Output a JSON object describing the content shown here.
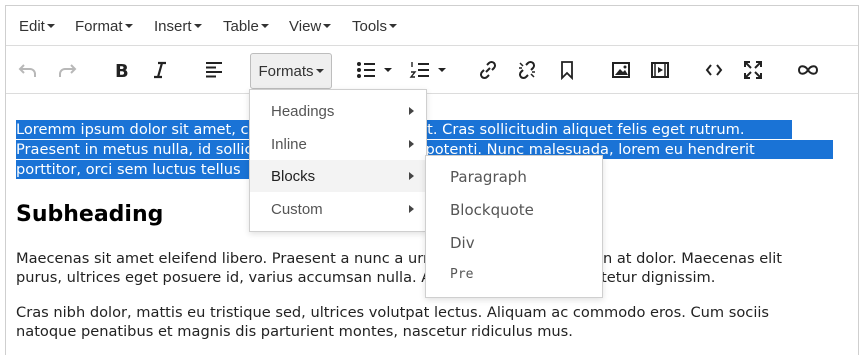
{
  "menubar": {
    "items": [
      {
        "label": "Edit"
      },
      {
        "label": "Format"
      },
      {
        "label": "Insert"
      },
      {
        "label": "Table"
      },
      {
        "label": "View"
      },
      {
        "label": "Tools"
      }
    ]
  },
  "toolbar": {
    "formats_label": "Formats",
    "icons": [
      "undo-icon",
      "redo-icon",
      "bold-icon",
      "italic-icon",
      "align-left-icon",
      "bullet-list-icon",
      "numbered-list-icon",
      "link-icon",
      "unlink-icon",
      "bookmark-icon",
      "image-icon",
      "media-icon",
      "code-icon",
      "fullscreen-icon",
      "spellcheck-icon"
    ]
  },
  "content": {
    "selected_lines": [
      "Loremm ipsum dolor sit amet, consectetur adipiscing elit. Cras sollicitudin aliquet felis eget rutrum.",
      "Praesent in metus nulla, id sollicitudin leo. Suspendisse potenti. Nunc malesuada, lorem eu hendrerit",
      "porttitor, orci sem luctus tellus"
    ],
    "heading": "Subheading",
    "paragraph1": [
      "Maecenas sit amet eleifend libero. Praesent a nunc a urna consequat ultrices non at dolor. Maecenas elit",
      "purus, ultrices eget posuere id, varius accumsan nulla. Aliquam sit amet consectetur dignissim."
    ],
    "paragraph2": [
      "Cras nibh dolor, mattis eu tristique sed, ultrices volutpat lectus. Aliquam ac commodo eros. Cum sociis",
      "natoque penatibus et magnis dis parturient montes, nascetur ridiculus mus."
    ]
  },
  "formats_menu": {
    "items": [
      {
        "label": "Headings"
      },
      {
        "label": "Inline"
      },
      {
        "label": "Blocks"
      },
      {
        "label": "Custom"
      }
    ]
  },
  "blocks_submenu": {
    "items": [
      {
        "label": "Paragraph"
      },
      {
        "label": "Blockquote"
      },
      {
        "label": "Div"
      },
      {
        "label": "Pre"
      }
    ]
  },
  "colors": {
    "selection": "#1a73d6"
  }
}
